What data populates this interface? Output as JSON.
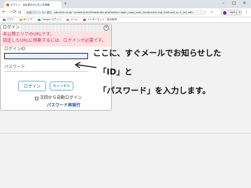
{
  "browser": {
    "tab_title": "ログイン - 自治体向け公共入札情報",
    "new_tab": "+",
    "window_controls": [
      "–",
      "□",
      "×"
    ],
    "back": "←",
    "forward": "→",
    "reload": "⟳",
    "home": "⌂",
    "security_label": "保護されていない通信",
    "url": "yabuichi.ne.jp/~ymatsu/cmd/FindsIndex.php?action=login_view_main_conference_mg_%d&next_p=1_cat_adb...",
    "star": "☆",
    "pause_label": "一時停止中",
    "menu": "⋮",
    "bookmarks": [
      "アプリ",
      "Bリンク",
      "Google ログイン",
      "メール",
      "インターネット - 自治体申..."
    ]
  },
  "dialog": {
    "title": "ログイン",
    "close": "×",
    "error_line1": "非公開エリアのURLです。",
    "error_line2": "指定したURLに移動するには、ログインが必要です。",
    "id_label": "ログインID",
    "id_value": "",
    "password_label": "パスワード",
    "login_button": "ログイン",
    "cancel_button": "キャンセル",
    "auto_login": "次回から自動ログイン",
    "reissue_link": "パスワード再発行"
  },
  "annotation": {
    "arrow": "←",
    "line1": "ここに、すぐメールでお知らせした",
    "line2": "「ID」と",
    "line3": "「パスワード」を入力します。"
  },
  "colors": {
    "error_text": "#e0245e",
    "error_bg": "#fde2e2",
    "link": "#1f4fae",
    "button_border": "#6fb1d1"
  }
}
